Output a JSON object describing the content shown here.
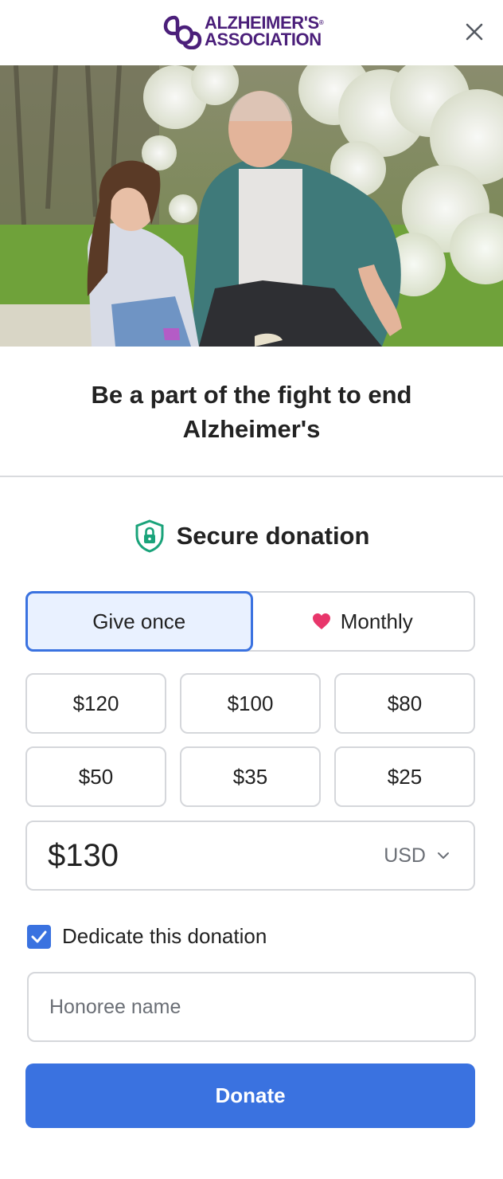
{
  "brand": {
    "name_line1": "ALZHEIMER'S",
    "name_line2": "ASSOCIATION",
    "registered": "®",
    "color": "#4b1f7a"
  },
  "header": {
    "close_icon": "close-icon"
  },
  "hero": {
    "icon": "photo-grandfather-granddaughter"
  },
  "headline": {
    "line1": "Be a part of the fight to end",
    "line2": "Alzheimer's"
  },
  "secure": {
    "icon": "shield-lock-icon",
    "label": "Secure donation",
    "icon_color": "#1aa37a"
  },
  "frequency": {
    "options": [
      {
        "label": "Give once",
        "selected": true
      },
      {
        "label": "Monthly",
        "icon": "heart-icon",
        "selected": false
      }
    ]
  },
  "amounts": [
    "$120",
    "$100",
    "$80",
    "$50",
    "$35",
    "$25"
  ],
  "amount_field": {
    "value": "$130",
    "currency": "USD",
    "currency_icon": "chevron-down-icon"
  },
  "dedicate": {
    "checked": true,
    "label": "Dedicate this donation"
  },
  "honoree": {
    "placeholder": "Honoree name",
    "value": ""
  },
  "donate": {
    "label": "Donate",
    "color": "#3a72e0"
  },
  "colors": {
    "accent": "#3a72e0",
    "selected_bg": "#e9f1ff",
    "heart": "#e8366b",
    "border": "#d5d7db"
  }
}
